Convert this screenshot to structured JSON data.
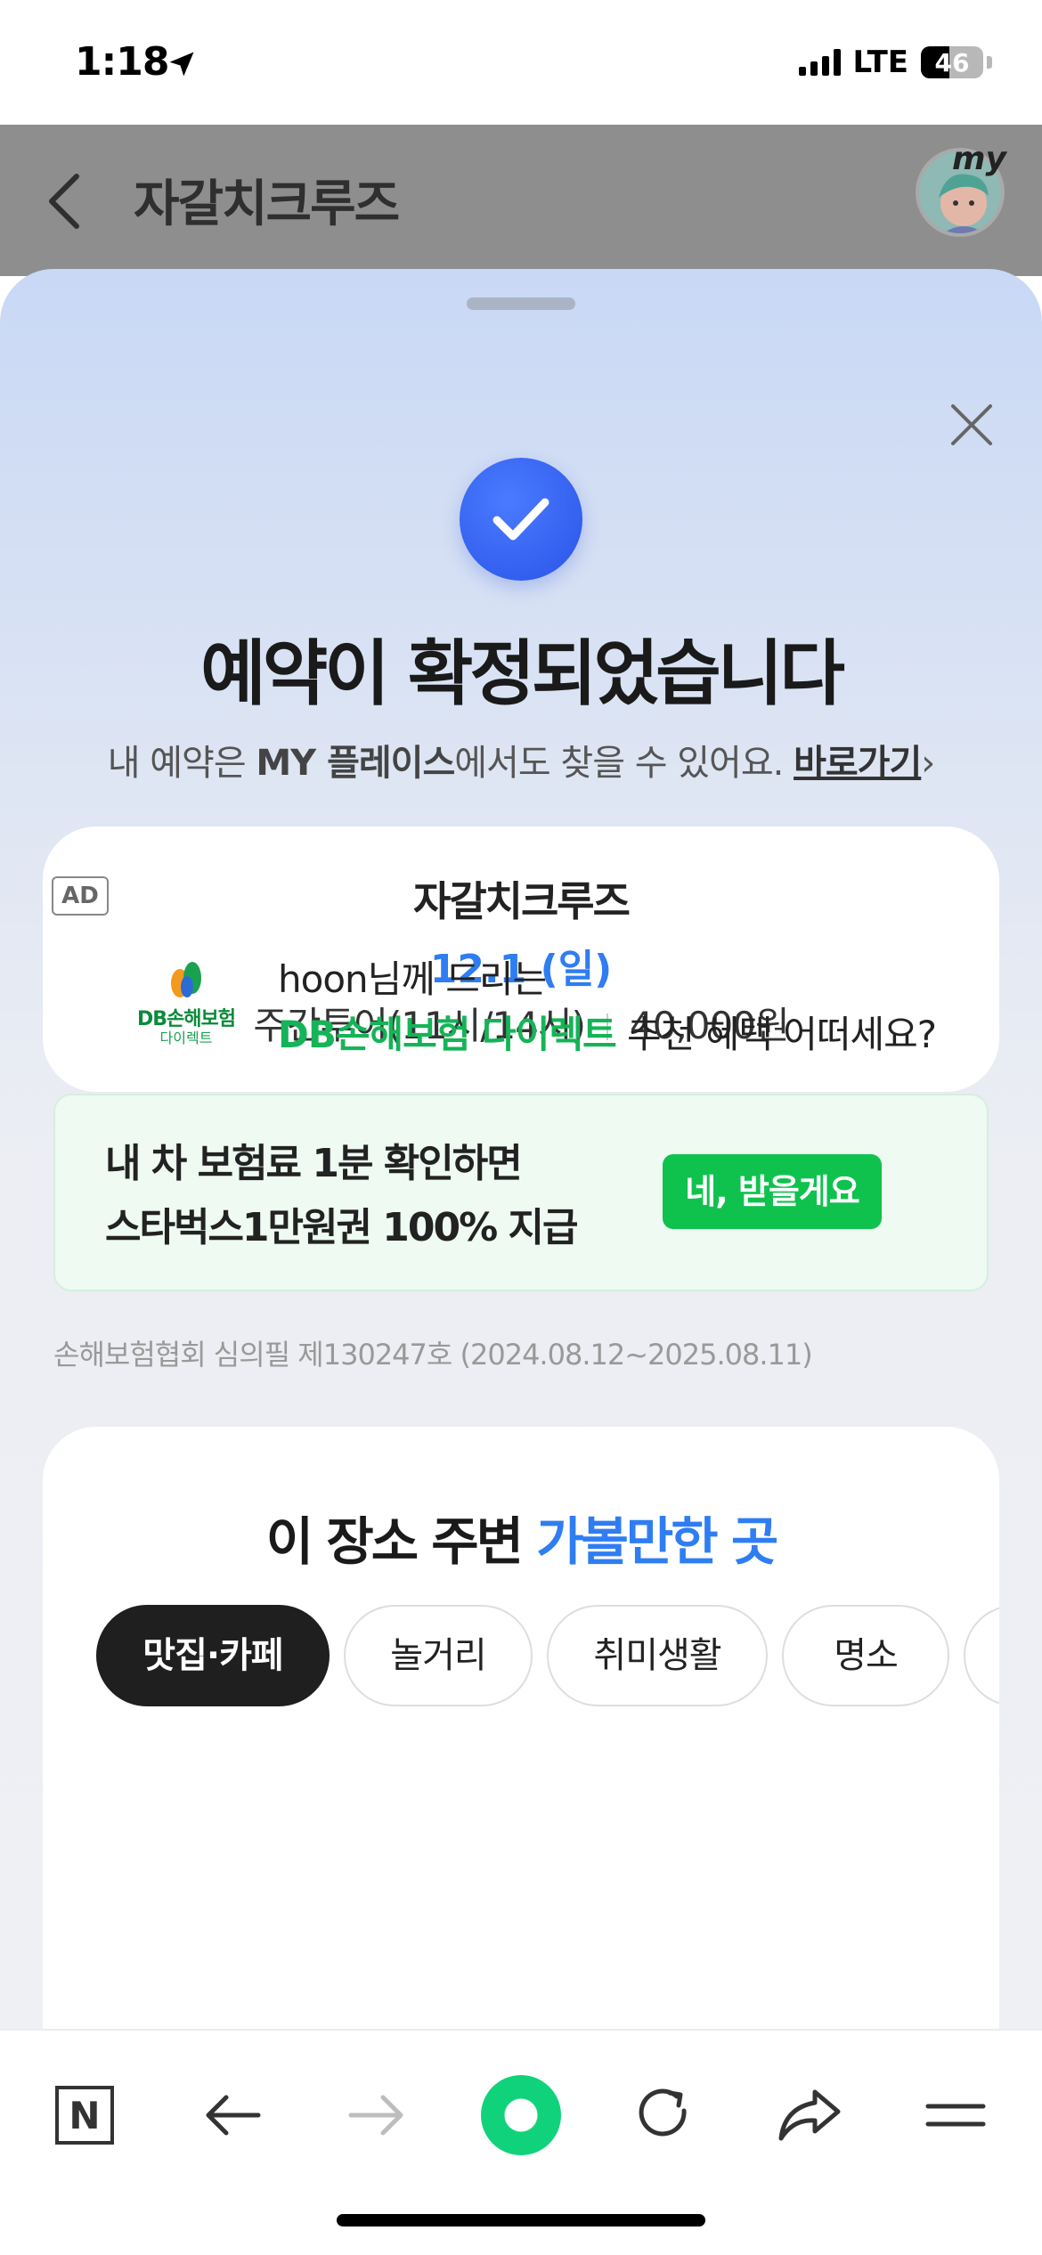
{
  "status_bar": {
    "time": "1:18",
    "network": "LTE",
    "battery": "46"
  },
  "header": {
    "title": "자갈치크루즈",
    "my_badge": "my"
  },
  "confirmation": {
    "title": "예약이 확정되었습니다",
    "sub_prefix": "내 예약은 ",
    "sub_bold": "MY 플레이스",
    "sub_suffix": "에서도 찾을 수 있어요.",
    "shortcut_link": "바로가기",
    "shortcut_chevron": "›"
  },
  "booking": {
    "name": "자갈치크루즈",
    "date": "12.1 (일)",
    "option": "주간투어(11시/14시)",
    "price": "40,000원"
  },
  "ad": {
    "badge": "AD",
    "logo_line1": "DB손해보험",
    "logo_line2": "다이렉트",
    "line1": "hoon님께 드리는",
    "brand": "DB손해보험 다이렉트",
    "line2_suffix": " 추천 혜택 어떠세요?",
    "promo_line1": "내 차 보험료 1분 확인하면",
    "promo_line2": "스타벅스1만원권 100% 지급",
    "cta": "네, 받을게요",
    "disclaimer": "손해보험협회 심의필 제130247호 (2024.08.12~2025.08.11)"
  },
  "nearby": {
    "title_prefix": "이 장소 주변 ",
    "title_highlight": "가볼만한 곳",
    "chips": [
      "맛집·카페",
      "놀거리",
      "취미생활",
      "명소"
    ]
  },
  "colors": {
    "accent_blue": "#2f7df2",
    "brand_green": "#14b457",
    "cta_green": "#0fc24e"
  },
  "bottom_bar": {
    "icons": [
      "naver-n-icon",
      "back-arrow-icon",
      "forward-arrow-icon",
      "green-dot-icon",
      "refresh-icon",
      "share-icon",
      "menu-icon"
    ],
    "naver_letter": "N"
  }
}
